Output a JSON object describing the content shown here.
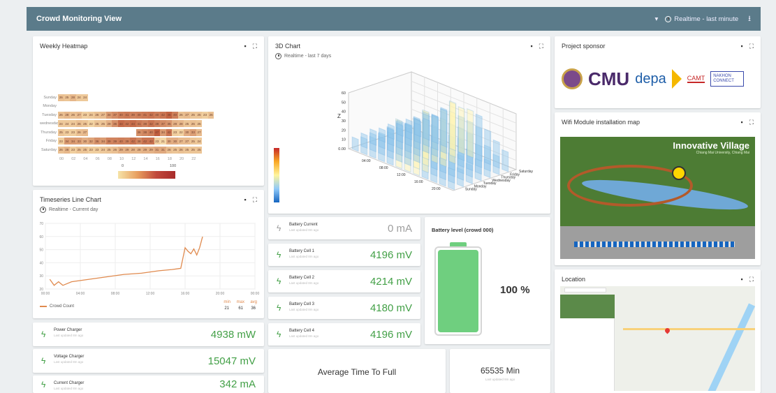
{
  "header": {
    "title": "Crowd Monitoring View",
    "time_range": "Realtime - last minute"
  },
  "heatmap": {
    "title": "Weekly Heatmap",
    "rows": [
      {
        "day": "Sunday",
        "values": [
          "26",
          "25",
          "28",
          "24",
          "24"
        ]
      },
      {
        "day": "Monday",
        "values": []
      },
      {
        "day": "Tuesday",
        "values": [
          "26",
          "28",
          "26",
          "27",
          "23",
          "24",
          "26",
          "27",
          "34",
          "37",
          "40",
          "41",
          "39",
          "40",
          "41",
          "42",
          "40",
          "42",
          "46",
          "40",
          "26",
          "27",
          "25",
          "25",
          "23",
          "26"
        ]
      },
      {
        "day": "wednesday",
        "values": [
          "24",
          "24",
          "24",
          "26",
          "25",
          "22",
          "25",
          "25",
          "29",
          "36",
          "44",
          "42",
          "44",
          "41",
          "39",
          "42",
          "39",
          "37",
          "35",
          "29",
          "28",
          "25",
          "26",
          "25"
        ]
      },
      {
        "day": "Thursday",
        "values": [
          "25",
          "23",
          "23",
          "26",
          "27",
          "",
          "",
          "",
          "",
          "",
          "",
          "",
          "",
          "36",
          "38",
          "40",
          "47",
          "34",
          "42",
          "23",
          "22",
          "30",
          "33",
          "27"
        ]
      },
      {
        "day": "Friday",
        "values": [
          "23",
          "34",
          "34",
          "33",
          "30",
          "32",
          "36",
          "34",
          "39",
          "39",
          "40",
          "39",
          "42",
          "38",
          "42",
          "42",
          "23",
          "21",
          "30",
          "30",
          "27",
          "27",
          "25",
          "24"
        ]
      },
      {
        "day": "Saturday",
        "values": [
          "26",
          "28",
          "23",
          "25",
          "25",
          "23",
          "23",
          "24",
          "25",
          "26",
          "29",
          "29",
          "28",
          "28",
          "29",
          "29",
          "31",
          "31",
          "26",
          "25",
          "26",
          "25",
          "25",
          "25"
        ]
      }
    ],
    "x_ticks": [
      "00",
      "02",
      "04",
      "06",
      "08",
      "10",
      "12",
      "14",
      "16",
      "18",
      "20",
      "22"
    ],
    "scale_min": "0",
    "scale_max": "100"
  },
  "chart3d": {
    "title": "3D Chart",
    "subtitle": "Realtime - last 7 days",
    "z_ticks": [
      "60",
      "50",
      "40",
      "30",
      "20",
      "10",
      "0.00"
    ],
    "z_label": "Z",
    "x_ticks": [
      "04:00",
      "08:00",
      "12:00",
      "16:00",
      "20:00"
    ],
    "y_ticks": [
      "Saturday",
      "Friday",
      "Thursday",
      "Wednesday",
      "Tuesday",
      "Monday",
      "Sunday"
    ]
  },
  "sponsor": {
    "title": "Project sponsor",
    "logos": [
      "CMU",
      "depa",
      "CAMT",
      "NAKHON CONNECT"
    ]
  },
  "wifi": {
    "title": "Wifi Module installation map",
    "map_title": "Innovative Village",
    "map_sub": "Chiang Mai University, Chiang Mai"
  },
  "timeseries": {
    "title": "Timeseries Line Chart",
    "subtitle": "Realtime - Current day",
    "y_ticks": [
      "70",
      "60",
      "50",
      "40",
      "30",
      "20"
    ],
    "x_ticks": [
      "00:00",
      "04:00",
      "08:00",
      "12:00",
      "16:00",
      "20:00",
      "00:00"
    ],
    "legend": "Crowd Count",
    "stats": {
      "min_label": "min",
      "max_label": "max",
      "avg_label": "avg",
      "min": "21",
      "max": "61",
      "avg": "36"
    },
    "color": "#e08a4e"
  },
  "chart_data": {
    "type": "line",
    "title": "Timeseries Line Chart",
    "x": [
      "00:30",
      "01:00",
      "01:30",
      "02:00",
      "03:00",
      "05:00",
      "07:00",
      "09:00",
      "11:00",
      "13:00",
      "14:30",
      "15:30",
      "16:00",
      "16:20",
      "16:40",
      "17:00",
      "17:20",
      "17:40",
      "18:00"
    ],
    "series": [
      {
        "name": "Crowd Count",
        "values": [
          26,
          21,
          24,
          21,
          24,
          26,
          28,
          30,
          31,
          33,
          34,
          35,
          52,
          49,
          47,
          51,
          46,
          52,
          61
        ]
      }
    ],
    "ylim": [
      18,
      72
    ]
  },
  "metrics": [
    {
      "key": "battery_current",
      "name": "Battery Current",
      "sub": "Last updated 8m ago",
      "value": "0 mA",
      "muted": true
    },
    {
      "key": "battery_cell_1",
      "name": "Battery Cell 1",
      "sub": "Last updated 8m ago",
      "value": "4196 mV"
    },
    {
      "key": "battery_cell_2",
      "name": "Battery Cell 2",
      "sub": "Last updated 8m ago",
      "value": "4214 mV"
    },
    {
      "key": "battery_cell_3",
      "name": "Battery Cell 3",
      "sub": "Last updated 8m ago",
      "value": "4180 mV"
    },
    {
      "key": "battery_cell_4",
      "name": "Battery Cell 4",
      "sub": "Last updated 8m ago",
      "value": "4196 mV"
    },
    {
      "key": "power_charger",
      "name": "Power Charger",
      "sub": "Last updated 8m ago",
      "value": "4938 mW"
    },
    {
      "key": "voltage_charger",
      "name": "Voltage Charger",
      "sub": "Last updated 8m ago",
      "value": "15047 mV"
    },
    {
      "key": "current_charger",
      "name": "Current Charger",
      "sub": "Last updated 8m ago",
      "value": "342 mA"
    }
  ],
  "battery": {
    "title": "Battery level (crowd 000)",
    "level_text": "100 %",
    "level": 1.0,
    "color": "#6fcf7f"
  },
  "avg_time": {
    "label": "Average Time To Full",
    "value": "65535 Min",
    "sub": "Last updated 8m ago"
  },
  "location": {
    "title": "Location"
  }
}
